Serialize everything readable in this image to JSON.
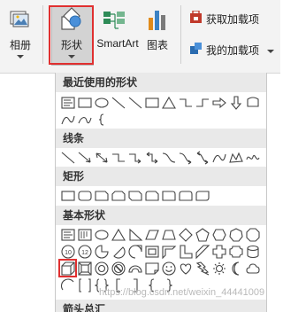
{
  "ribbon": {
    "album_label": "相册",
    "shapes_label": "形状",
    "smartart_label": "SmartArt",
    "chart_label": "图表",
    "get_addins_label": "获取加载项",
    "my_addins_label": "我的加载项",
    "colors": {
      "selection_red": "#e03030",
      "addin_red": "#c0392b",
      "addin_blue": "#2b6cb0",
      "chart_blue": "#3b82c4",
      "chart_orange": "#e08b1a",
      "smartart_green": "#2e8b57"
    }
  },
  "gallery": {
    "sections": [
      {
        "title": "最近使用的形状",
        "shapes": [
          "text-box",
          "rectangle",
          "oval",
          "line",
          "line-diagonal",
          "rectangle-outline",
          "triangle",
          "elbow-connector",
          "elbow-connector-reverse",
          "right-arrow",
          "down-arrow",
          "flowchart-process",
          "curve",
          "freeform-curve",
          "brace-left"
        ]
      },
      {
        "title": "线条",
        "shapes": [
          "line",
          "arrow",
          "double-arrow",
          "elbow-connector",
          "elbow-arrow",
          "elbow-double-arrow",
          "curved-connector",
          "curved-arrow",
          "curved-double-arrow",
          "curve",
          "freeform",
          "scribble"
        ]
      },
      {
        "title": "矩形",
        "shapes": [
          "rectangle",
          "rounded-rectangle",
          "snip-single-corner",
          "snip-same-side",
          "snip-diagonal",
          "snip-round",
          "round-single-corner",
          "round-same-side",
          "round-diagonal"
        ]
      },
      {
        "title": "基本形状",
        "shapes": [
          "text-box",
          "vertical-text-box",
          "oval",
          "triangle",
          "right-triangle",
          "parallelogram",
          "trapezoid",
          "diamond",
          "pentagon",
          "hexagon",
          "heptagon",
          "octagon",
          "decagon",
          "dodecagon",
          "pie",
          "chord",
          "teardrop",
          "frame",
          "half-frame",
          "l-shape",
          "diagonal-stripe",
          "cross",
          "plaque",
          "can",
          "cube",
          "bevel",
          "donut",
          "no-symbol",
          "block-arc",
          "folded-corner",
          "smiley-face",
          "heart",
          "lightning-bolt",
          "sun",
          "moon",
          "cloud",
          "arc",
          "double-bracket",
          "double-brace",
          "left-bracket",
          "right-bracket",
          "left-brace",
          "right-brace"
        ]
      }
    ],
    "next_section_title": "箭头总汇",
    "highlighted_shape": "cube"
  },
  "watermark": "https://blog.csdn.net/weixin_44441009"
}
